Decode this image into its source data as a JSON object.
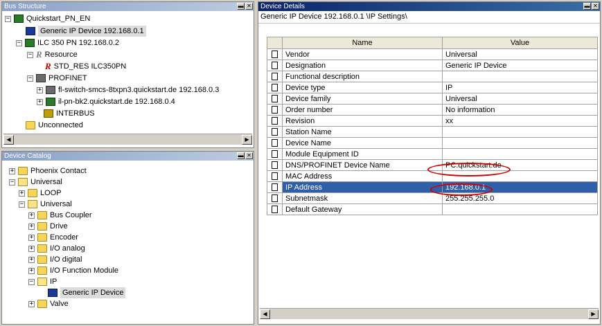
{
  "bus_structure": {
    "title": "Bus Structure",
    "tree": [
      {
        "label": "Quickstart_PN_EN"
      },
      {
        "label": "Generic IP Device 192.168.0.1"
      },
      {
        "label": "ILC 350 PN 192.168.0.2"
      },
      {
        "label": "Resource"
      },
      {
        "label": "STD_RES ILC350PN"
      },
      {
        "label": "PROFINET"
      },
      {
        "label": "fl-switch-smcs-8txpn3.quickstart.de 192.168.0.3"
      },
      {
        "label": "il-pn-bk2.quickstart.de 192.168.0.4"
      },
      {
        "label": "INTERBUS"
      },
      {
        "label": "Unconnected"
      }
    ]
  },
  "device_catalog": {
    "title": "Device Catalog",
    "tree": [
      {
        "label": "Phoenix Contact"
      },
      {
        "label": "Universal"
      },
      {
        "label": "LOOP"
      },
      {
        "label": "Universal"
      },
      {
        "label": "Bus Coupler"
      },
      {
        "label": "Drive"
      },
      {
        "label": "Encoder"
      },
      {
        "label": "I/O analog"
      },
      {
        "label": "I/O digital"
      },
      {
        "label": "I/O Function Module"
      },
      {
        "label": "IP"
      },
      {
        "label": "Generic IP Device"
      },
      {
        "label": "Valve"
      }
    ]
  },
  "device_details": {
    "title": "Device Details",
    "breadcrumb": "Generic IP Device 192.168.0.1 \\IP Settings\\",
    "columns": {
      "name": "Name",
      "value": "Value"
    },
    "rows": [
      {
        "name": "Vendor",
        "value": "Universal"
      },
      {
        "name": "Designation",
        "value": "Generic IP Device"
      },
      {
        "name": "Functional description",
        "value": ""
      },
      {
        "name": "Device type",
        "value": "IP"
      },
      {
        "name": "Device family",
        "value": "Universal"
      },
      {
        "name": "Order number",
        "value": "No information"
      },
      {
        "name": "Revision",
        "value": "xx"
      },
      {
        "name": "Station Name",
        "value": ""
      },
      {
        "name": "Device Name",
        "value": ""
      },
      {
        "name": "Module Equipment ID",
        "value": ""
      },
      {
        "name": "DNS/PROFINET Device Name",
        "value": "PC.quickstart.de"
      },
      {
        "name": "MAC Address",
        "value": ""
      },
      {
        "name": "IP Address",
        "value": "192.168.0.1"
      },
      {
        "name": "Subnetmask",
        "value": "255.255.255.0"
      },
      {
        "name": "Default Gateway",
        "value": ""
      }
    ]
  },
  "window_buttons": {
    "minimize": "▬",
    "close": "✕"
  },
  "scroll_arrows": {
    "left": "◀",
    "right": "▶"
  },
  "colors": {
    "active_title": "#0a246a",
    "selected_row": "#2f5fa8",
    "highlight_oval": "#d00000"
  }
}
